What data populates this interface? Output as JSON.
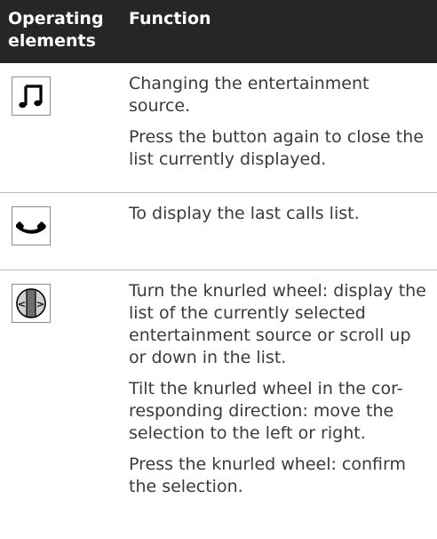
{
  "header": {
    "operating": "Operating elements",
    "function": "Function"
  },
  "rows": [
    {
      "icon": "music-note-icon",
      "paragraphs": [
        "Changing the entertainment source.",
        "Press the button again to close the list currently displayed."
      ]
    },
    {
      "icon": "phone-handset-icon",
      "paragraphs": [
        "To display the last calls list."
      ]
    },
    {
      "icon": "knurled-wheel-icon",
      "wheel_left_glyph": "<",
      "wheel_right_glyph": ">",
      "paragraphs": [
        "Turn the knurled wheel: display the list of the currently selected entertainment source or scroll up or down in the list.",
        "Tilt the knurled wheel in the cor-responding direction: move the selection to the left or right.",
        "Press the knurled wheel: confirm the selection."
      ]
    }
  ]
}
